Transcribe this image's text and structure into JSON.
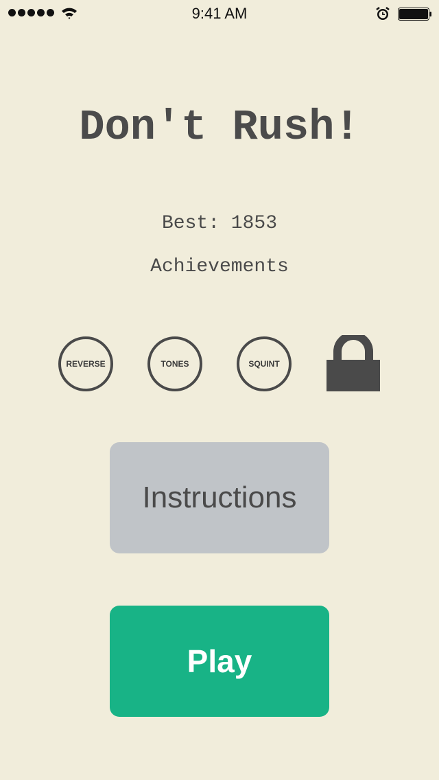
{
  "status_bar": {
    "time": "9:41 AM",
    "signal_dots": 5,
    "icons": [
      "signal-icon",
      "wifi-icon",
      "alarm-icon",
      "battery-icon"
    ],
    "battery_level": 1.0
  },
  "title": "Don't Rush!",
  "best_score": "Best: 1853",
  "achievements_label": "Achievements",
  "achievements": [
    {
      "label": "REVERSE"
    },
    {
      "label": "TONES"
    },
    {
      "label": "SQUINT"
    },
    {
      "label": "",
      "icon": "lock-icon",
      "locked": true
    }
  ],
  "buttons": {
    "instructions": "Instructions",
    "play": "Play"
  },
  "colors": {
    "background": "#f1eddb",
    "text": "#4a4a4a",
    "instructions_button": "#c0c4c8",
    "play_button": "#18b386"
  }
}
